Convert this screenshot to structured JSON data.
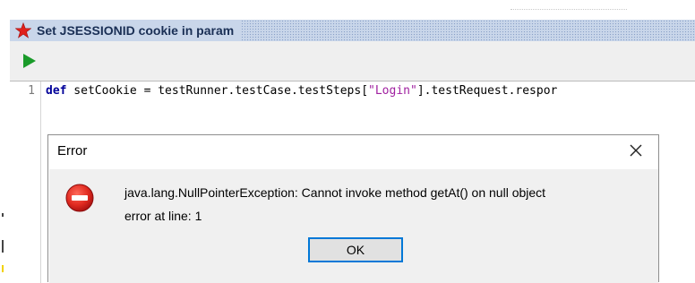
{
  "window": {
    "title": "Set JSESSIONID cookie in param"
  },
  "editor": {
    "line_number": "1",
    "code": {
      "kw_def": "def",
      "before_str": " setCookie = testRunner.testCase.testSteps[",
      "str": "\"Login\"",
      "after_str": "].testRequest.respor"
    }
  },
  "dialog": {
    "title": "Error",
    "message": "java.lang.NullPointerException: Cannot invoke method getAt() on null object",
    "detail": "error at line: 1",
    "ok_label": "OK"
  },
  "colors": {
    "accent": "#0078d7",
    "star": "#e0201b",
    "run": "#1a9b2a",
    "error": "#d42020"
  },
  "icons": {
    "title": "star-icon",
    "run": "play-icon",
    "close": "close-icon",
    "error": "error-icon"
  }
}
